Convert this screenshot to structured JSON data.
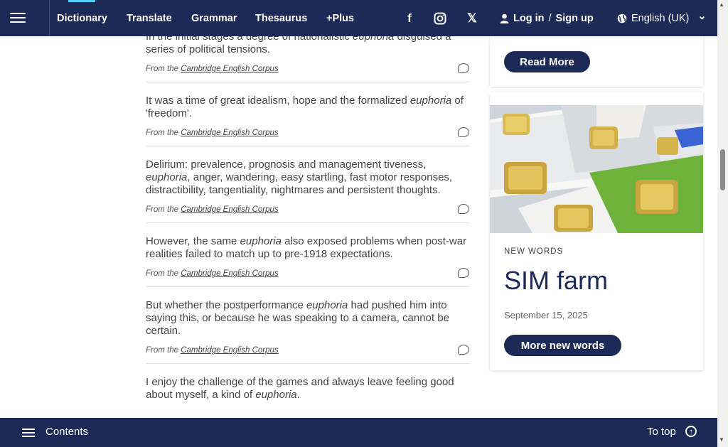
{
  "nav": {
    "items": [
      {
        "label": "Dictionary",
        "active": true
      },
      {
        "label": "Translate"
      },
      {
        "label": "Grammar"
      },
      {
        "label": "Thesaurus"
      },
      {
        "label": "+Plus"
      }
    ],
    "social": {
      "facebook": "f",
      "x": "𝕏"
    },
    "login": "Log in",
    "slash": "/",
    "signup": "Sign up",
    "language": "English (UK)",
    "lang_arrow": "⌄"
  },
  "examples": [
    {
      "before": "In the initial stages a degree of nationalistic ",
      "word": "euphoria",
      "after": " disguised a series of political tensions.",
      "src_prefix": "From the ",
      "src_link": "Cambridge English Corpus"
    },
    {
      "before": "It was a time of great idealism, hope and the formalized ",
      "word": "euphoria",
      "after": " of 'freedom'.",
      "src_prefix": "From the ",
      "src_link": "Cambridge English Corpus"
    },
    {
      "before": "Delirium: prevalence, prognosis and management tiveness, ",
      "word": "euphoria",
      "after": ", anger, wandering, easy startling, fast motor responses, distractibility, tangentiality, nightmares and persistent thoughts.",
      "src_prefix": "From the ",
      "src_link": "Cambridge English Corpus"
    },
    {
      "before": "However, the same ",
      "word": "euphoria",
      "after": " also exposed problems when post-war realities failed to match up to pre-1918 expectations.",
      "src_prefix": "From the ",
      "src_link": "Cambridge English Corpus"
    },
    {
      "before": "But whether the postperformance ",
      "word": "euphoria",
      "after": " had pushed him into saying this, or because he was speaking to a camera, cannot be certain.",
      "src_prefix": "From the ",
      "src_link": "Cambridge English Corpus"
    },
    {
      "before": "I enjoy the challenge of the games and always leave feeling good about myself, a kind of ",
      "word": "euphoria",
      "after": ".",
      "src_prefix": "",
      "src_link": ""
    }
  ],
  "sidebar": {
    "read_more": "Read More",
    "new_words_label": "NEW WORDS",
    "new_word_title": "SIM farm",
    "new_word_date": "September 15, 2025",
    "more_new_words": "More new words"
  },
  "bottom": {
    "contents": "Contents",
    "to_top": "To top",
    "to_top_arrow": "↑"
  },
  "colors": {
    "brand_navy": "#1d2a57",
    "accent_cyan": "#4fd0f8"
  }
}
